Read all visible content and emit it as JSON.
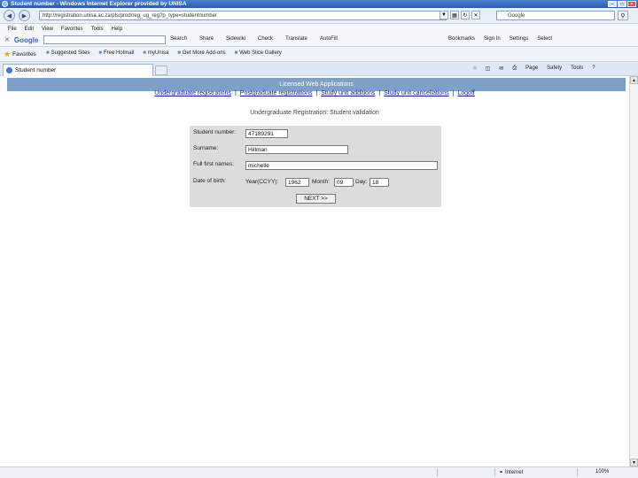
{
  "window": {
    "title": "Student number - Windows Internet Explorer provided by UNISA"
  },
  "address_bar": {
    "url": "http://registration.unisa.ac.za/pls/prod/reg_ug_reg?p_type=studentnumber",
    "search_text": "Google"
  },
  "menu": [
    "File",
    "Edit",
    "View",
    "Favorites",
    "Tools",
    "Help"
  ],
  "google_toolbar": {
    "logo": "Google",
    "tools": [
      "Search",
      "Share",
      "Sidewiki",
      "Check",
      "Translate",
      "AutoFill"
    ],
    "right_tools": [
      "Bookmarks",
      "Sign In",
      "Settings",
      "Select"
    ]
  },
  "favorites": {
    "label": "Favorites",
    "links": [
      "Suggested Sites",
      "Free Hotmail",
      "myUnisa",
      "Get More Add-ons",
      "Web Slice Gallery"
    ]
  },
  "tab": {
    "title": "Student number"
  },
  "command_bar": [
    "Page",
    "Safety",
    "Tools"
  ],
  "page": {
    "banner": "Licensed Web Applications",
    "nav_links": [
      "Undergraduate registrations",
      "Postgraduate registrations",
      "Study unit additions",
      "Study unit cancellations",
      "Logoff"
    ],
    "separator": "|",
    "subtitle": "Undergraduate Registration: Student validation",
    "form": {
      "student_number_label": "Student number:",
      "student_number_value": "47189291",
      "surname_label": "Surname:",
      "surname_value": "Hillman",
      "full_first_names_label": "Full first names:",
      "full_first_names_value": "michelle",
      "dob_label": "Date of birth:",
      "year_label": "Year(CCYY):",
      "year_value": "1962",
      "month_label": "Month:",
      "month_value": "09",
      "day_label": "Day:",
      "day_value": "18",
      "next_button": "NEXT >>"
    }
  },
  "status_bar": {
    "zone": "Internet",
    "zoom": "100%"
  }
}
